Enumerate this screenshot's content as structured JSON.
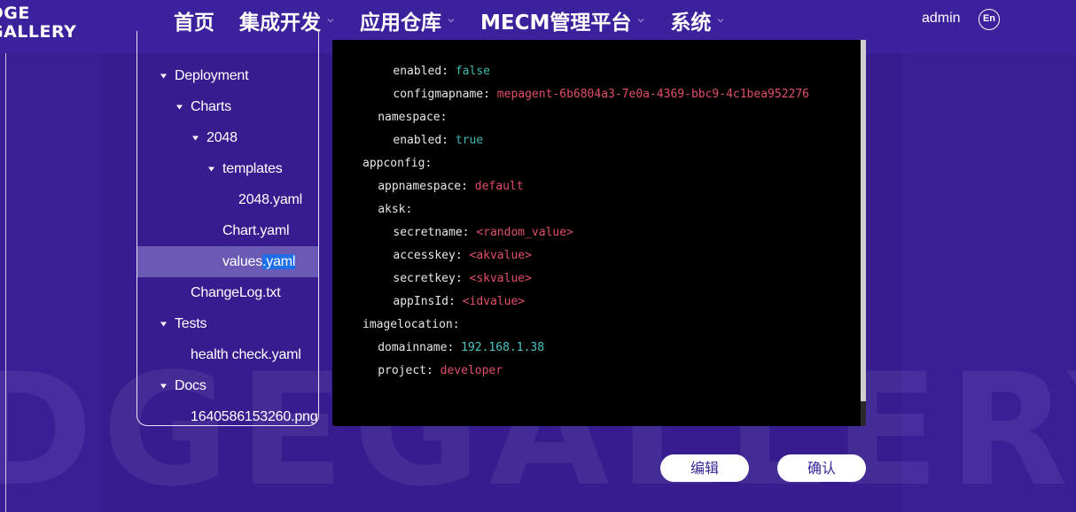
{
  "header": {
    "logo_line1": "DGE",
    "logo_line2": "GALLERY",
    "nav": [
      {
        "label": "首页",
        "has_caret": false
      },
      {
        "label": "集成开发",
        "has_caret": true
      },
      {
        "label": "应用仓库",
        "has_caret": true
      },
      {
        "label": "MECM管理平台",
        "has_caret": true
      },
      {
        "label": "系统",
        "has_caret": true
      }
    ],
    "user": "admin",
    "lang": "En"
  },
  "watermark": "DGEGALLERY",
  "tree": {
    "items": [
      {
        "label": "Deployment",
        "depth": 0,
        "expandable": true
      },
      {
        "label": "Charts",
        "depth": 1,
        "expandable": true
      },
      {
        "label": "2048",
        "depth": 2,
        "expandable": true
      },
      {
        "label": "templates",
        "depth": 3,
        "expandable": true
      },
      {
        "label": "2048.yaml",
        "depth": 4,
        "expandable": false
      },
      {
        "label": "Chart.yaml",
        "depth": 3,
        "expandable": false
      },
      {
        "label_before": "values",
        "label_highlight": ".yaml",
        "depth": 3,
        "expandable": false,
        "selected": true
      },
      {
        "label": "ChangeLog.txt",
        "depth": 1,
        "expandable": false
      },
      {
        "label": "Tests",
        "depth": 0,
        "expandable": true
      },
      {
        "label": "health check.yaml",
        "depth": 1,
        "expandable": false
      },
      {
        "label": "Docs",
        "depth": 0,
        "expandable": true
      },
      {
        "label": "1640586153260.png",
        "depth": 1,
        "expandable": false
      }
    ]
  },
  "editor": {
    "lines": [
      {
        "indent": 4,
        "key": "enabled:",
        "value": "false",
        "vtype": "bool"
      },
      {
        "indent": 4,
        "key": "configmapname:",
        "value": "mepagent-6b6804a3-7e0a-4369-bbc9-4c1bea952276",
        "vtype": "str"
      },
      {
        "indent": 2,
        "key": "namespace:",
        "value": "",
        "vtype": "none"
      },
      {
        "indent": 4,
        "key": "enabled:",
        "value": "true",
        "vtype": "bool"
      },
      {
        "indent": 0,
        "key": "appconfig:",
        "value": "",
        "vtype": "none"
      },
      {
        "indent": 2,
        "key": "appnamespace:",
        "value": "default",
        "vtype": "str"
      },
      {
        "indent": 2,
        "key": "aksk:",
        "value": "",
        "vtype": "none"
      },
      {
        "indent": 4,
        "key": "secretname:",
        "value": "<random_value>",
        "vtype": "str"
      },
      {
        "indent": 4,
        "key": "accesskey:",
        "value": "<akvalue>",
        "vtype": "str"
      },
      {
        "indent": 4,
        "key": "secretkey:",
        "value": "<skvalue>",
        "vtype": "str"
      },
      {
        "indent": 4,
        "key": "appInsId:",
        "value": "<idvalue>",
        "vtype": "str"
      },
      {
        "indent": 0,
        "key": "imagelocation:",
        "value": "",
        "vtype": "none"
      },
      {
        "indent": 2,
        "key": "domainname:",
        "value": "192.168.1.38",
        "vtype": "num"
      },
      {
        "indent": 2,
        "key": "project:",
        "value": "developer",
        "vtype": "str"
      }
    ]
  },
  "buttons": {
    "edit": "编辑",
    "confirm": "确认"
  }
}
